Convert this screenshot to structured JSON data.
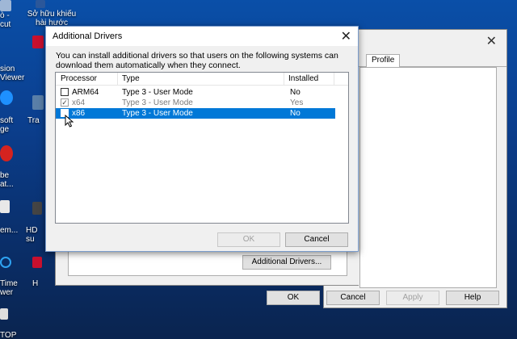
{
  "desktop": {
    "icons": [
      {
        "label": "Sở hữu khiếu\nhài hước"
      },
      {
        "label": "ò -\ncut"
      },
      {
        "label": "sion\nViewer"
      },
      {
        "label": "soft\nge"
      },
      {
        "label": "be\nat..."
      },
      {
        "label": "em..."
      },
      {
        "label": "HD\nsu"
      },
      {
        "label": "Time\nwer"
      },
      {
        "label": "TOP"
      }
    ]
  },
  "back_window": {
    "tab_label": "Profile",
    "additional_drivers_button": "Additional Drivers...",
    "buttons": {
      "ok": "OK",
      "cancel": "Cancel",
      "apply": "Apply",
      "help": "Help"
    }
  },
  "dialog": {
    "title": "Additional Drivers",
    "description": "You can install additional drivers so that users on the following systems can download them automatically when they connect.",
    "columns": {
      "processor": "Processor",
      "type": "Type",
      "installed": "Installed"
    },
    "rows": [
      {
        "processor": "ARM64",
        "type": "Type 3 - User Mode",
        "installed": "No",
        "checked": false,
        "dimmed": false,
        "selected": false
      },
      {
        "processor": "x64",
        "type": "Type 3 - User Mode",
        "installed": "Yes",
        "checked": true,
        "dimmed": true,
        "selected": false
      },
      {
        "processor": "x86",
        "type": "Type 3 - User Mode",
        "installed": "No",
        "checked": false,
        "dimmed": false,
        "selected": true
      }
    ],
    "buttons": {
      "ok": "OK",
      "cancel": "Cancel"
    },
    "check_glyph": "✓"
  },
  "colors": {
    "selection": "#0078d7",
    "desktop": "#0b3f8f"
  }
}
